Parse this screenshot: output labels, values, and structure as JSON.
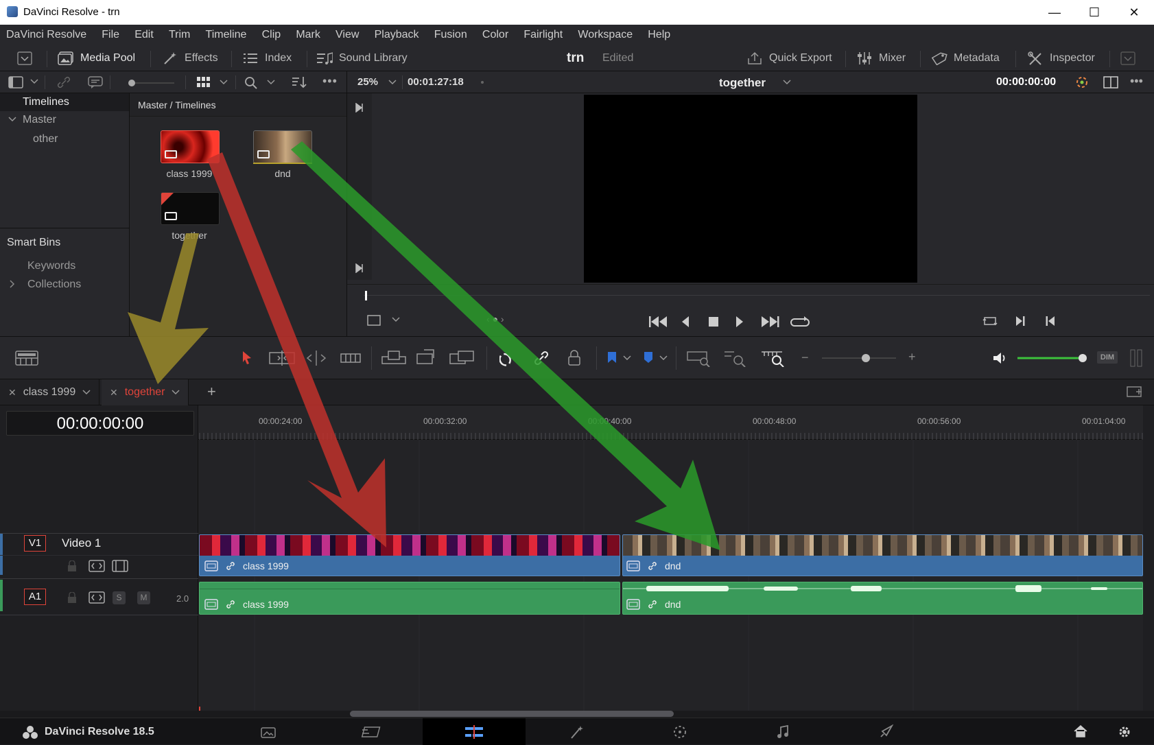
{
  "window": {
    "title": "DaVinci Resolve - trn",
    "minimize": "—",
    "maximize": "☐",
    "close": "✕"
  },
  "menu": [
    "DaVinci Resolve",
    "File",
    "Edit",
    "Trim",
    "Timeline",
    "Clip",
    "Mark",
    "View",
    "Playback",
    "Fusion",
    "Color",
    "Fairlight",
    "Workspace",
    "Help"
  ],
  "toolbar": {
    "media_pool": "Media Pool",
    "effects": "Effects",
    "index": "Index",
    "sound_library": "Sound Library",
    "project": "trn",
    "status": "Edited",
    "quick_export": "Quick Export",
    "mixer": "Mixer",
    "metadata": "Metadata",
    "inspector": "Inspector"
  },
  "subbar": {
    "zoom": "25%",
    "source_timecode": "00:01:27:18",
    "timeline_name": "together",
    "record_timecode": "00:00:00:00"
  },
  "bins": {
    "header": "Timelines",
    "master": "Master",
    "child": "other",
    "smart_bins": "Smart Bins",
    "keywords": "Keywords",
    "collections": "Collections"
  },
  "pool": {
    "path": "Master / Timelines",
    "clips": [
      {
        "name": "class 1999"
      },
      {
        "name": "dnd"
      },
      {
        "name": "together"
      }
    ]
  },
  "timeline": {
    "tabs": [
      {
        "name": "class 1999"
      },
      {
        "name": "together"
      }
    ],
    "add_tab": "+",
    "current_timecode": "00:00:00:00",
    "ruler_labels": [
      "00:00:24:00",
      "00:00:32:00",
      "00:00:40:00",
      "00:00:48:00",
      "00:00:56:00",
      "00:01:04:00"
    ],
    "video_track": {
      "id": "V1",
      "name": "Video 1"
    },
    "audio_track": {
      "id": "A1",
      "solo": "S",
      "mute": "M",
      "channels": "2.0"
    },
    "clips": {
      "v1_left": "class 1999",
      "v1_right": "dnd",
      "a1_left": "class 1999",
      "a1_right": "dnd"
    }
  },
  "tltools": {
    "dim": "DIM"
  },
  "footer": {
    "brand": "DaVinci Resolve 18.5"
  },
  "colors": {
    "accent_red": "#e0443a",
    "clip_blue": "#3c6ea5",
    "clip_green": "#3a9a5a",
    "arrow_red": "#c0312b",
    "arrow_green": "#2a9a2a",
    "arrow_yellow": "#9a8a2a"
  }
}
